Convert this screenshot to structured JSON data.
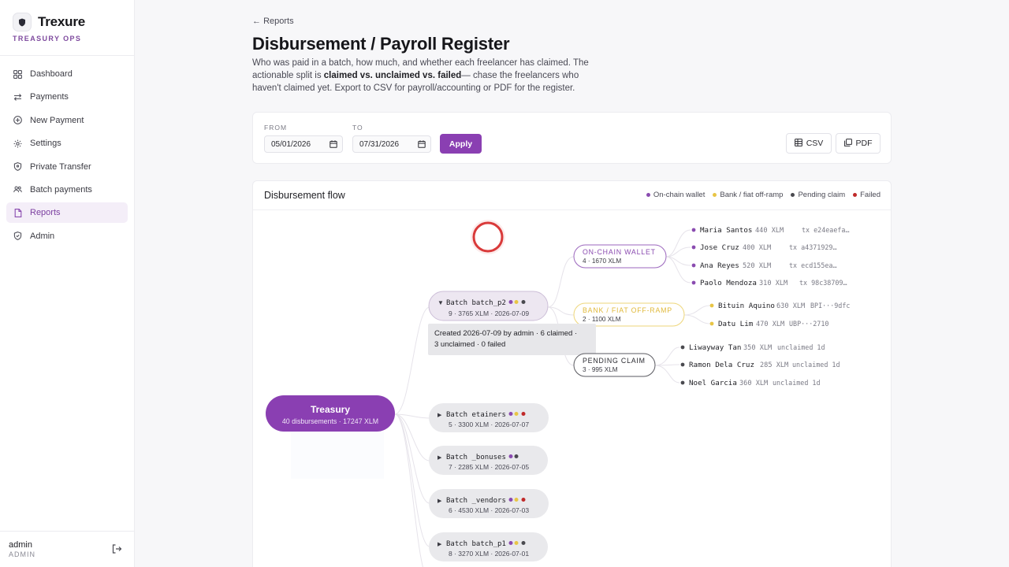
{
  "brand": {
    "name": "Trexure",
    "subtitle": "TREASURY OPS"
  },
  "nav": [
    {
      "label": "Dashboard",
      "icon": "grid-icon"
    },
    {
      "label": "Payments",
      "icon": "arrows-icon"
    },
    {
      "label": "New Payment",
      "icon": "plus-circle-icon"
    },
    {
      "label": "Settings",
      "icon": "gear-icon"
    },
    {
      "label": "Private Transfer",
      "icon": "shield-icon"
    },
    {
      "label": "Batch payments",
      "icon": "users-icon"
    },
    {
      "label": "Reports",
      "icon": "document-icon",
      "active": true
    },
    {
      "label": "Admin",
      "icon": "shield-check-icon"
    }
  ],
  "user": {
    "name": "admin",
    "role": "ADMIN"
  },
  "page": {
    "back": "Reports",
    "title": "Disbursement / Payroll Register",
    "desc_1": "Who was paid in a batch, how much, and whether each freelancer has claimed. The actionable split is ",
    "desc_bold": "claimed vs. unclaimed vs. failed",
    "desc_2": "— chase the freelancers who haven't claimed yet. Export to CSV for payroll/accounting or PDF for the register."
  },
  "filters": {
    "from_label": "FROM",
    "from_value": "05/01/2026",
    "to_label": "TO",
    "to_value": "07/31/2026",
    "apply": "Apply",
    "csv": "CSV",
    "pdf": "PDF"
  },
  "flow": {
    "title": "Disbursement flow",
    "legend": [
      {
        "label": "On-chain wallet",
        "color": "#8a4bb0"
      },
      {
        "label": "Bank / fiat off-ramp",
        "color": "#e8c545"
      },
      {
        "label": "Pending claim",
        "color": "#4a4a4f"
      },
      {
        "label": "Failed",
        "color": "#c02a2a"
      }
    ],
    "treasury": {
      "title": "Treasury",
      "sub": "40 disbursements · 17247 XLM"
    },
    "batches": [
      {
        "label": "Batch batch_p2",
        "sub": "9 · 3765 XLM · 2026-07-09",
        "expanded": true,
        "dots": [
          "#8a4bb0",
          "#e8c545",
          "#4a4a4f"
        ]
      },
      {
        "label": "Batch etainers",
        "sub": "5 · 3300 XLM · 2026-07-07",
        "expanded": false,
        "dots": [
          "#8a4bb0",
          "#e8c545",
          "#c02a2a"
        ]
      },
      {
        "label": "Batch _bonuses",
        "sub": "7 · 2285 XLM · 2026-07-05",
        "expanded": false,
        "dots": [
          "#8a4bb0",
          "#4a4a4f"
        ]
      },
      {
        "label": "Batch _vendors",
        "sub": "6 · 4530 XLM · 2026-07-03",
        "expanded": false,
        "dots": [
          "#8a4bb0",
          "#e8c545",
          "#c02a2a"
        ]
      },
      {
        "label": "Batch batch_p1",
        "sub": "8 · 3270 XLM · 2026-07-01",
        "expanded": false,
        "dots": [
          "#8a4bb0",
          "#e8c545",
          "#4a4a4f"
        ]
      }
    ],
    "tooltip": {
      "line1": "Created 2026-07-09 by admin · 6 claimed ·",
      "line2": "3 unclaimed · 0 failed"
    },
    "groups": [
      {
        "title": "ON-CHAIN WALLET",
        "sub": "4 · 1670 XLM",
        "color": "#8a4bb0",
        "rows": [
          {
            "name": "Maria Santos",
            "amt": "440 XLM",
            "note": "tx e24eaefa…"
          },
          {
            "name": "Jose Cruz",
            "amt": "400 XLM",
            "note": "tx a4371929…"
          },
          {
            "name": "Ana Reyes",
            "amt": "520 XLM",
            "note": "tx ecd155ea…"
          },
          {
            "name": "Paolo Mendoza",
            "amt": "310 XLM",
            "note": "tx 98c38709…"
          }
        ]
      },
      {
        "title": "BANK / FIAT OFF-RAMP",
        "sub": "2 · 1100 XLM",
        "color": "#e8c545",
        "rows": [
          {
            "name": "Bituin Aquino",
            "amt": "630 XLM",
            "note": "BPI···9dfc"
          },
          {
            "name": "Datu Lim",
            "amt": "470 XLM",
            "note": "UBP···2710"
          }
        ]
      },
      {
        "title": "PENDING CLAIM",
        "sub": "3 · 995 XLM",
        "color": "#4a4a4f",
        "rows": [
          {
            "name": "Liwayway Tan",
            "amt": "350 XLM",
            "note": "unclaimed 1d"
          },
          {
            "name": "Ramon Dela Cruz",
            "amt": "285 XLM",
            "note": "unclaimed 1d"
          },
          {
            "name": "Noel Garcia",
            "amt": "360 XLM",
            "note": "unclaimed 1d"
          }
        ]
      }
    ]
  }
}
